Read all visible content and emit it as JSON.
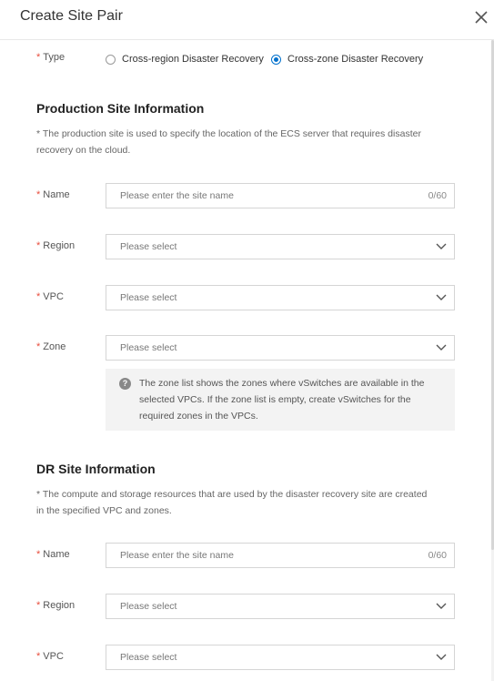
{
  "dialog": {
    "title": "Create Site Pair"
  },
  "type_field": {
    "label": "Type",
    "options": [
      {
        "label": "Cross-region Disaster Recovery",
        "selected": false
      },
      {
        "label": "Cross-zone Disaster Recovery",
        "selected": true
      }
    ]
  },
  "production": {
    "title": "Production Site Information",
    "description": "* The production site is used to specify the location of the ECS server that requires disaster recovery on the cloud.",
    "name": {
      "label": "Name",
      "placeholder": "Please enter the site name",
      "counter": "0/60"
    },
    "region": {
      "label": "Region",
      "placeholder": "Please select"
    },
    "vpc": {
      "label": "VPC",
      "placeholder": "Please select"
    },
    "zone": {
      "label": "Zone",
      "placeholder": "Please select"
    },
    "zone_info": "The zone list shows the zones where vSwitches are available in the selected VPCs. If the zone list is empty, create vSwitches for the required zones in the VPCs."
  },
  "dr": {
    "title": "DR Site Information",
    "description": "* The compute and storage resources that are used by the disaster recovery site are created in the specified VPC and zones.",
    "name": {
      "label": "Name",
      "placeholder": "Please enter the site name",
      "counter": "0/60"
    },
    "region": {
      "label": "Region",
      "placeholder": "Please select"
    },
    "vpc": {
      "label": "VPC",
      "placeholder": "Please select"
    }
  },
  "required_mark": "*",
  "info_icon_glyph": "?",
  "colors": {
    "accent": "#0070cc",
    "required": "#e84d3d",
    "info_bg": "#f3f3f3"
  }
}
